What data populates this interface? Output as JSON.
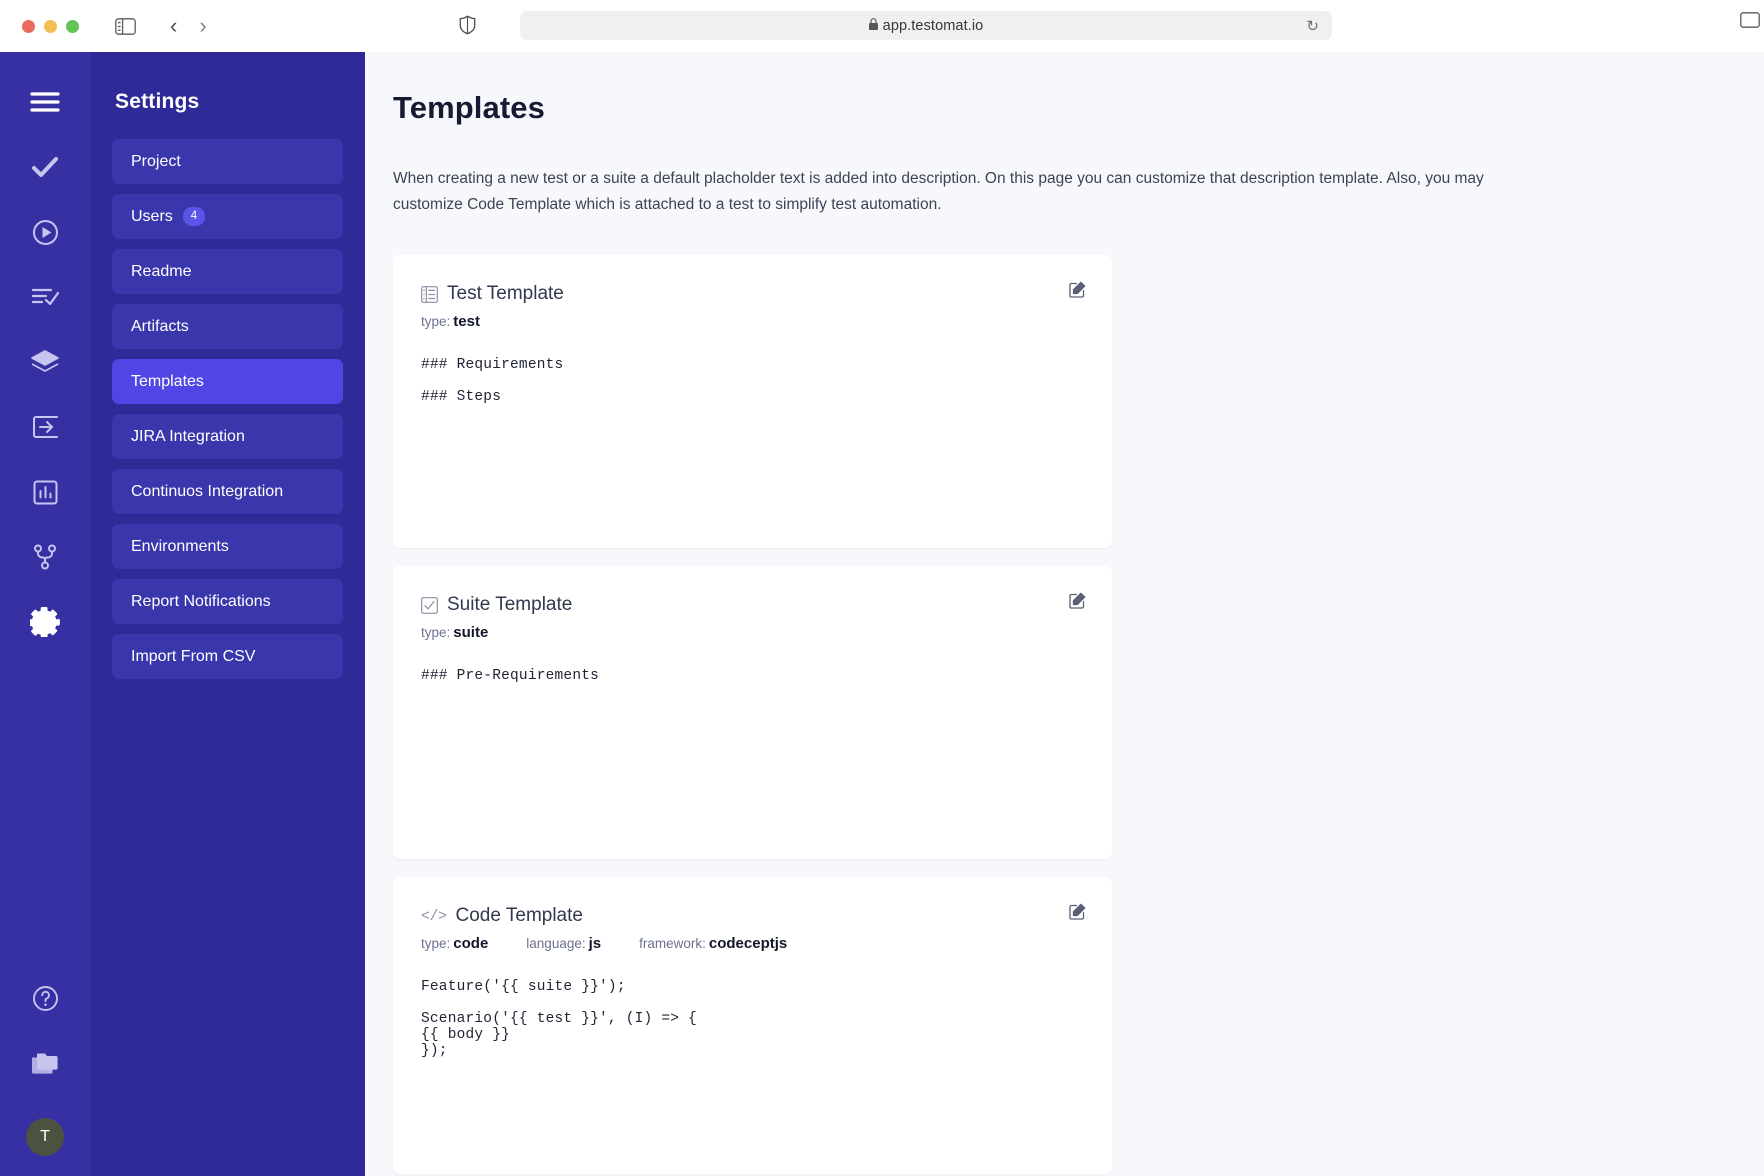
{
  "browser": {
    "url": "app.testomat.io",
    "lock_glyph": "\u0001",
    "icons": {
      "sidebar_toggle": "sidebar-toggle-icon",
      "back": "‹",
      "forward": "›",
      "shield": "shield-icon",
      "reload": "↻"
    }
  },
  "rail": {
    "items": [
      {
        "name": "menu-icon",
        "active": false
      },
      {
        "name": "check-icon",
        "active": false
      },
      {
        "name": "play-circle-icon",
        "active": false
      },
      {
        "name": "list-check-icon",
        "active": false
      },
      {
        "name": "layers-icon",
        "active": false
      },
      {
        "name": "import-icon",
        "active": false
      },
      {
        "name": "analytics-icon",
        "active": false
      },
      {
        "name": "branch-icon",
        "active": false
      },
      {
        "name": "gear-icon",
        "active": true
      }
    ],
    "bottom": [
      {
        "name": "help-icon"
      },
      {
        "name": "folders-icon"
      }
    ],
    "avatar_initial": "T"
  },
  "sidebar": {
    "title": "Settings",
    "items": [
      {
        "label": "Project",
        "active": false
      },
      {
        "label": "Users",
        "badge": "4",
        "active": false
      },
      {
        "label": "Readme",
        "active": false
      },
      {
        "label": "Artifacts",
        "active": false
      },
      {
        "label": "Templates",
        "active": true
      },
      {
        "label": "JIRA Integration",
        "active": false
      },
      {
        "label": "Continuos Integration",
        "active": false
      },
      {
        "label": "Environments",
        "active": false
      },
      {
        "label": "Report Notifications",
        "active": false
      },
      {
        "label": "Import From CSV",
        "active": false
      }
    ]
  },
  "main": {
    "title": "Templates",
    "description": "When creating a new test or a suite a default placholder text is added into description. On this page you can customize that description template. Also, you may customize Code Template which is attached to a test to simplify test automation.",
    "cards": [
      {
        "icon": "list-table-icon",
        "title": "Test Template",
        "meta": [
          {
            "key": "type:",
            "value": "test"
          }
        ],
        "body": "### Requirements\n\n### Steps",
        "edit_icon": "edit-icon"
      },
      {
        "icon": "checkbox-icon",
        "title": "Suite Template",
        "meta": [
          {
            "key": "type:",
            "value": "suite"
          }
        ],
        "body": "### Pre-Requirements",
        "edit_icon": "edit-icon"
      },
      {
        "icon": "code-icon",
        "icon_glyph": "</>",
        "title": "Code Template",
        "meta": [
          {
            "key": "type:",
            "value": "code"
          },
          {
            "key": "language:",
            "value": "js"
          },
          {
            "key": "framework:",
            "value": "codeceptjs"
          }
        ],
        "body": "Feature('{{ suite }}');\n\nScenario('{{ test }}', (I) => {\n{{ body }}\n});",
        "edit_icon": "edit-icon"
      }
    ]
  },
  "colors": {
    "rail_bg": "#3730a3",
    "sidebar_bg": "#2e2a97",
    "nav_item_bg": "#3a36ab",
    "nav_active_bg": "#4f46e5",
    "page_bg": "#f7f8fc",
    "card_bg": "#ffffff"
  }
}
